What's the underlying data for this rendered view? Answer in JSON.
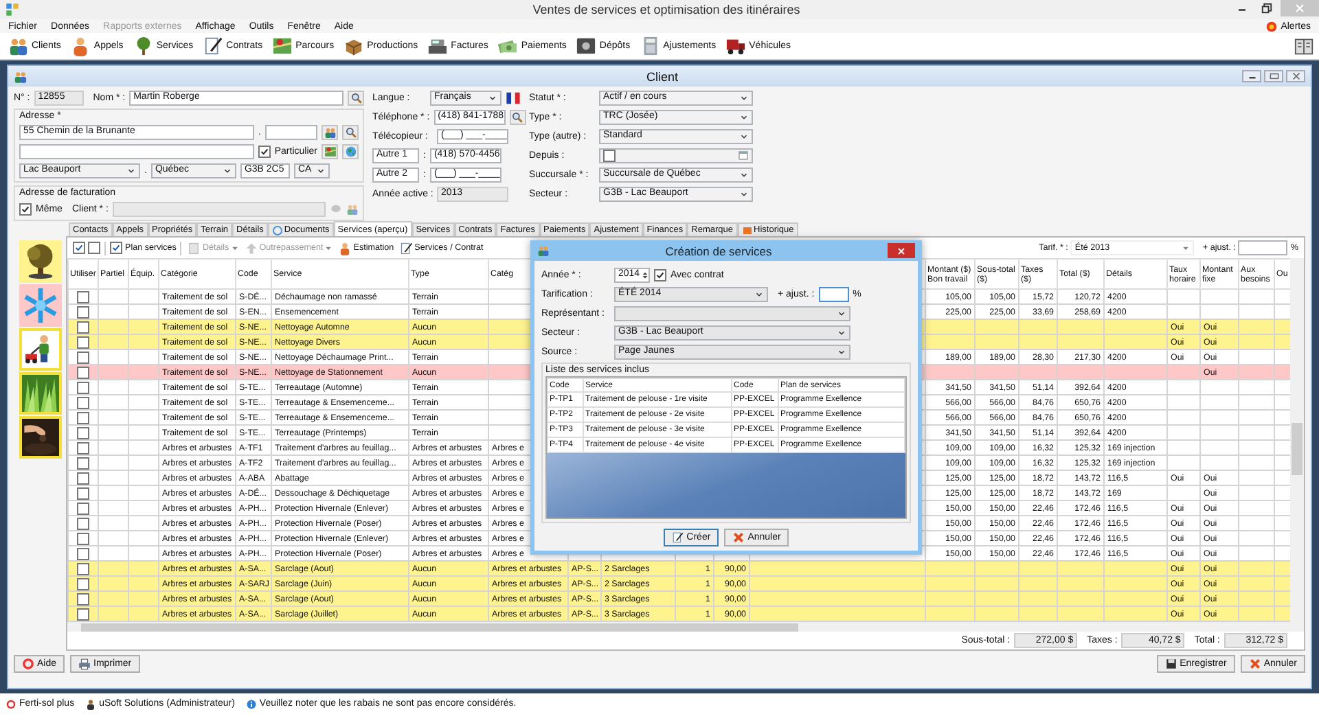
{
  "window": {
    "title": "Ventes de services et optimisation des itinéraires"
  },
  "menu": [
    {
      "label": "Fichier",
      "disabled": false
    },
    {
      "label": "Données",
      "disabled": false
    },
    {
      "label": "Rapports externes",
      "disabled": true
    },
    {
      "label": "Affichage",
      "disabled": false
    },
    {
      "label": "Outils",
      "disabled": false
    },
    {
      "label": "Fenêtre",
      "disabled": false
    },
    {
      "label": "Aide",
      "disabled": false
    }
  ],
  "alerts": "Alertes",
  "toolbar": [
    "Clients",
    "Appels",
    "Services",
    "Contrats",
    "Parcours",
    "Productions",
    "Factures",
    "Paiements",
    "Dépôts",
    "Ajustements",
    "Véhicules"
  ],
  "client": {
    "title": "Client",
    "number": {
      "label": "N° :",
      "value": "12855"
    },
    "name": {
      "label": "Nom * :",
      "value": "Martin Roberge"
    },
    "address": {
      "legend": "Adresse *",
      "street": "55 Chemin de la Brunante",
      "separator_1": ".",
      "separator_2": ".",
      "private": {
        "label": "Particulier",
        "checked": true
      },
      "city": "Lac Beauport",
      "province": "Québec",
      "postal_code": "G3B 2C5",
      "country": "CA"
    },
    "billing": {
      "legend": "Adresse de facturation",
      "same": {
        "label": "Même",
        "checked": true
      },
      "client_label": "Client * :"
    },
    "contact_fields": [
      {
        "kind": "select",
        "label": "Langue :",
        "value": "Français"
      },
      {
        "kind": "text",
        "label": "Téléphone * :",
        "value": "(418) 841-1788"
      },
      {
        "kind": "text",
        "label": "Télécopieur :",
        "value": "(___) ___-____"
      },
      {
        "kind": "custom",
        "label": "Autre 1",
        "colon": ":",
        "value": "(418) 570-4456"
      },
      {
        "kind": "custom",
        "label": "Autre 2",
        "colon": ":",
        "value": "(___) ___-____"
      },
      {
        "kind": "readonly",
        "label": "Année active :",
        "value": "2013"
      }
    ],
    "status_fields": [
      {
        "kind": "select",
        "label": "Statut * :",
        "value": "Actif / en cours"
      },
      {
        "kind": "select",
        "label": "Type * :",
        "value": "TRC (Josée)"
      },
      {
        "kind": "select",
        "label": "Type (autre) :",
        "value": "Standard"
      },
      {
        "kind": "date",
        "label": "Depuis :",
        "checked": false
      },
      {
        "kind": "select",
        "label": "Succursale * :",
        "value": "Succursale de Québec"
      },
      {
        "kind": "select",
        "label": "Secteur :",
        "value": "G3B - Lac Beauport"
      }
    ]
  },
  "tabs": [
    {
      "label": "Contacts",
      "selected": false
    },
    {
      "label": "Appels",
      "selected": false
    },
    {
      "label": "Propriétés",
      "selected": false
    },
    {
      "label": "Terrain",
      "selected": false
    },
    {
      "label": "Détails",
      "selected": false
    },
    {
      "label": "Documents",
      "selected": false
    },
    {
      "label": "Services (aperçu)",
      "selected": true
    },
    {
      "label": "Services",
      "selected": false
    },
    {
      "label": "Contrats",
      "selected": false
    },
    {
      "label": "Factures",
      "selected": false
    },
    {
      "label": "Paiements",
      "selected": false
    },
    {
      "label": "Ajustement",
      "selected": false
    },
    {
      "label": "Finances",
      "selected": false
    },
    {
      "label": "Remarque",
      "selected": false
    },
    {
      "label": "Historique",
      "selected": false
    }
  ],
  "services_toolbar": {
    "select_all": {
      "checked": true
    },
    "select_none": {
      "checked": false
    },
    "plan_services": {
      "label": "Plan services",
      "checked": true
    },
    "buttons": [
      {
        "label": "Détails",
        "disabled": true,
        "dropdown": true
      },
      {
        "label": "Outrepassement",
        "disabled": true,
        "dropdown": true
      },
      {
        "label": "Estimation",
        "disabled": false,
        "dropdown": false
      },
      {
        "label": "Services / Contrat",
        "disabled": false,
        "dropdown": false
      }
    ],
    "rate_label": "Tarif. * :",
    "rate": "Été 2013",
    "adjust_label": "+ ajust. :",
    "adjust_unit": "%"
  },
  "table": {
    "columns": {
      "checked": "Utiliser",
      "partial": "Partiel",
      "equipment": "Équip.",
      "category": "Catégorie",
      "code": "Code",
      "service": "Service",
      "type": "Type",
      "category_2": "Catég",
      "amount": "Montant ($) Bon travail",
      "subtotal": "Sous-total ($)",
      "taxes": "Taxes ($)",
      "total": "Total ($)",
      "details": "Détails",
      "hourly_rate": "Taux horaire",
      "fixed_amount": "Montant fixe",
      "as_needed": "Aux besoins",
      "column_22": "Ou"
    },
    "rows": [
      {
        "checked": false,
        "color": "#ffffff",
        "category": "Traitement de sol",
        "code": "S-DÉ...",
        "service": "Déchaumage non ramassé",
        "type": "Terrain",
        "amount": "105,00",
        "subtotal": "105,00",
        "taxes": "15,72",
        "total": "120,72",
        "details": "4200"
      },
      {
        "checked": false,
        "color": "#ffffff",
        "category": "Traitement de sol",
        "code": "S-EN...",
        "service": "Ensemencement",
        "type": "Terrain",
        "amount": "225,00",
        "subtotal": "225,00",
        "taxes": "33,69",
        "total": "258,69",
        "details": "4200"
      },
      {
        "checked": false,
        "color": "#fff38f",
        "category": "Traitement de sol",
        "code": "S-NE...",
        "service": "Nettoyage Automne",
        "type": "Aucun",
        "hourly_rate": "Oui",
        "fixed_amount": "Oui"
      },
      {
        "checked": false,
        "color": "#fff38f",
        "category": "Traitement de sol",
        "code": "S-NE...",
        "service": "Nettoyage Divers",
        "type": "Aucun",
        "hourly_rate": "Oui",
        "fixed_amount": "Oui"
      },
      {
        "checked": false,
        "color": "#ffffff",
        "category": "Traitement de sol",
        "code": "S-NE...",
        "service": "Nettoyage Déchaumage Print...",
        "type": "Terrain",
        "amount": "189,00",
        "subtotal": "189,00",
        "taxes": "28,30",
        "total": "217,30",
        "details": "4200",
        "hourly_rate": "Oui",
        "fixed_amount": "Oui"
      },
      {
        "checked": false,
        "color": "#ffc8c8",
        "category": "Traitement de sol",
        "code": "S-NE...",
        "service": "Nettoyage de Stationnement",
        "type": "Aucun",
        "fixed_amount": "Oui"
      },
      {
        "checked": false,
        "color": "#ffffff",
        "category": "Traitement de sol",
        "code": "S-TE...",
        "service": "Terreautage (Automne)",
        "type": "Terrain",
        "amount": "341,50",
        "subtotal": "341,50",
        "taxes": "51,14",
        "total": "392,64",
        "details": "4200"
      },
      {
        "checked": false,
        "color": "#ffffff",
        "category": "Traitement de sol",
        "code": "S-TE...",
        "service": "Terreautage & Ensemenceme...",
        "type": "Terrain",
        "amount": "566,00",
        "subtotal": "566,00",
        "taxes": "84,76",
        "total": "650,76",
        "details": "4200"
      },
      {
        "checked": false,
        "color": "#ffffff",
        "category": "Traitement de sol",
        "code": "S-TE...",
        "service": "Terreautage & Ensemenceme...",
        "type": "Terrain",
        "amount": "566,00",
        "subtotal": "566,00",
        "taxes": "84,76",
        "total": "650,76",
        "details": "4200"
      },
      {
        "checked": false,
        "color": "#ffffff",
        "category": "Traitement de sol",
        "code": "S-TE...",
        "service": "Terreautage (Printemps)",
        "type": "Terrain",
        "amount": "341,50",
        "subtotal": "341,50",
        "taxes": "51,14",
        "total": "392,64",
        "details": "4200"
      },
      {
        "checked": false,
        "color": "#ffffff",
        "category": "Arbres et arbustes",
        "code": "A-TF1",
        "service": "Traitement d'arbres au feuillag...",
        "type": "Arbres et arbustes",
        "category_2": "Arbres e",
        "amount": "109,00",
        "subtotal": "109,00",
        "taxes": "16,32",
        "total": "125,32",
        "details": "169 injection"
      },
      {
        "checked": false,
        "color": "#ffffff",
        "category": "Arbres et arbustes",
        "code": "A-TF2",
        "service": "Traitement d'arbres au feuillag...",
        "type": "Arbres et arbustes",
        "category_2": "Arbres e",
        "amount": "109,00",
        "subtotal": "109,00",
        "taxes": "16,32",
        "total": "125,32",
        "details": "169 injection"
      },
      {
        "checked": false,
        "color": "#ffffff",
        "category": "Arbres et arbustes",
        "code": "A-ABA",
        "service": "Abattage",
        "type": "Arbres et arbustes",
        "category_2": "Arbres e",
        "amount": "125,00",
        "subtotal": "125,00",
        "taxes": "18,72",
        "total": "143,72",
        "details": "116,5",
        "hourly_rate": "Oui",
        "fixed_amount": "Oui"
      },
      {
        "checked": false,
        "color": "#ffffff",
        "category": "Arbres et arbustes",
        "code": "A-DÉ...",
        "service": "Dessouchage & Déchiquetage",
        "type": "Arbres et arbustes",
        "category_2": "Arbres e",
        "amount": "125,00",
        "subtotal": "125,00",
        "taxes": "18,72",
        "total": "143,72",
        "details": "169",
        "fixed_amount": "Oui"
      },
      {
        "checked": false,
        "color": "#ffffff",
        "category": "Arbres et arbustes",
        "code": "A-PH...",
        "service": "Protection Hivernale (Enlever)",
        "type": "Arbres et arbustes",
        "category_2": "Arbres e",
        "amount": "150,00",
        "subtotal": "150,00",
        "taxes": "22,46",
        "total": "172,46",
        "details": "116,5",
        "hourly_rate": "Oui",
        "fixed_amount": "Oui"
      },
      {
        "checked": false,
        "color": "#ffffff",
        "category": "Arbres et arbustes",
        "code": "A-PH...",
        "service": "Protection Hivernale (Poser)",
        "type": "Arbres et arbustes",
        "category_2": "Arbres e",
        "amount": "150,00",
        "subtotal": "150,00",
        "taxes": "22,46",
        "total": "172,46",
        "details": "116,5",
        "hourly_rate": "Oui",
        "fixed_amount": "Oui"
      },
      {
        "checked": false,
        "color": "#ffffff",
        "category": "Arbres et arbustes",
        "code": "A-PH...",
        "service": "Protection Hivernale (Enlever)",
        "type": "Arbres et arbustes",
        "category_2": "Arbres e",
        "amount": "150,00",
        "subtotal": "150,00",
        "taxes": "22,46",
        "total": "172,46",
        "details": "116,5",
        "hourly_rate": "Oui",
        "fixed_amount": "Oui"
      },
      {
        "checked": false,
        "color": "#ffffff",
        "category": "Arbres et arbustes",
        "code": "A-PH...",
        "service": "Protection Hivernale (Poser)",
        "type": "Arbres et arbustes",
        "category_2": "Arbres e",
        "amount": "150,00",
        "subtotal": "150,00",
        "taxes": "22,46",
        "total": "172,46",
        "details": "116,5",
        "hourly_rate": "Oui",
        "fixed_amount": "Oui"
      },
      {
        "checked": false,
        "color": "#fff38f",
        "category": "Arbres et arbustes",
        "code": "A-SA...",
        "service": "Sarclage (Aout)",
        "type": "Aucun",
        "category_2": "Arbres et arbustes",
        "code_2": "AP-S...",
        "plan": "2 Sarclages",
        "quantity": "1",
        "price": "90,00",
        "hourly_rate": "Oui",
        "fixed_amount": "Oui"
      },
      {
        "checked": false,
        "color": "#fff38f",
        "category": "Arbres et arbustes",
        "code": "A-SARJ",
        "service": "Sarclage (Juin)",
        "type": "Aucun",
        "category_2": "Arbres et arbustes",
        "code_2": "AP-S...",
        "plan": "2 Sarclages",
        "quantity": "1",
        "price": "90,00",
        "hourly_rate": "Oui",
        "fixed_amount": "Oui"
      },
      {
        "checked": false,
        "color": "#fff38f",
        "category": "Arbres et arbustes",
        "code": "A-SA...",
        "service": "Sarclage (Aout)",
        "type": "Aucun",
        "category_2": "Arbres et arbustes",
        "code_2": "AP-S...",
        "plan": "3 Sarclages",
        "quantity": "1",
        "price": "90,00",
        "hourly_rate": "Oui",
        "fixed_amount": "Oui"
      },
      {
        "checked": false,
        "color": "#fff38f",
        "category": "Arbres et arbustes",
        "code": "A-SA...",
        "service": "Sarclage (Juillet)",
        "type": "Aucun",
        "category_2": "Arbres et arbustes",
        "code_2": "AP-S...",
        "plan": "3 Sarclages",
        "quantity": "1",
        "price": "90,00",
        "hourly_rate": "Oui",
        "fixed_amount": "Oui"
      }
    ]
  },
  "totals": [
    {
      "label": "Sous-total :",
      "value": "272,00 $"
    },
    {
      "label": "Taxes :",
      "value": "40,72 $"
    },
    {
      "label": "Total :",
      "value": "312,72 $"
    }
  ],
  "footer_buttons_left": [
    "Aide",
    "Imprimer"
  ],
  "footer_buttons_right": [
    "Enregistrer",
    "Annuler"
  ],
  "dialog": {
    "title": "Création de services",
    "year": {
      "label": "Année * :",
      "value": "2014"
    },
    "contract": {
      "label": "Avec contrat",
      "checked": true
    },
    "pricing": {
      "label": "Tarification :",
      "value": "ÉTÉ 2014"
    },
    "adjust": {
      "label": "+ ajust. :",
      "unit": "%"
    },
    "representative": {
      "label": "Représentant :"
    },
    "sector": {
      "label": "Secteur :",
      "value": "G3B - Lac Beauport"
    },
    "source": {
      "label": "Source :",
      "value": "Page Jaunes"
    },
    "list_legend": "Liste des services inclus",
    "columns": [
      "Code",
      "Service",
      "Code",
      "Plan de services"
    ],
    "rows": [
      [
        "P-TP1",
        "Traitement de pelouse - 1re visite",
        "PP-EXCEL",
        "Programme Exellence"
      ],
      [
        "P-TP2",
        "Traitement de pelouse - 2e visite",
        "PP-EXCEL",
        "Programme Exellence"
      ],
      [
        "P-TP3",
        "Traitement de pelouse - 3e visite",
        "PP-EXCEL",
        "Programme Exellence"
      ],
      [
        "P-TP4",
        "Traitement de pelouse - 4e visite",
        "PP-EXCEL",
        "Programme Exellence"
      ]
    ],
    "buttons": [
      "Créer",
      "Annuler"
    ]
  },
  "status_bar": [
    "Ferti-sol plus",
    "uSoft Solutions (Administrateur)",
    "Veuillez noter que les rabais ne sont pas encore considérés."
  ]
}
